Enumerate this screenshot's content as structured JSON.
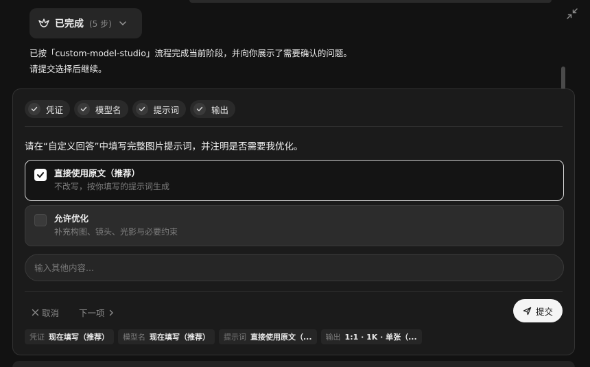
{
  "status": {
    "label": "已完成",
    "steps": "(5 步)"
  },
  "message": {
    "line1": "已按「custom-model-studio」流程完成当前阶段，并向你展示了需要确认的问题。",
    "line2": "请提交选择后继续。"
  },
  "chips": [
    "凭证",
    "模型名",
    "提示词",
    "输出"
  ],
  "question": "请在“自定义回答”中填写完整图片提示词，并注明是否需要我优化。",
  "options": [
    {
      "title": "直接使用原文（推荐）",
      "desc": "不改写，按你填写的提示词生成",
      "checked": true
    },
    {
      "title": "允许优化",
      "desc": "补充构图、镜头、光影与必要约束",
      "checked": false
    }
  ],
  "other_input": {
    "placeholder": "输入其他内容...",
    "value": ""
  },
  "actions": {
    "cancel": "取消",
    "next": "下一项",
    "submit": "提交"
  },
  "summary": [
    {
      "key": "凭证",
      "value": "现在填写（推荐）"
    },
    {
      "key": "模型名",
      "value": "现在填写（推荐）"
    },
    {
      "key": "提示词",
      "value": "直接使用原文（..."
    },
    {
      "key": "输出",
      "value": "1:1 · 1K · 单张（..."
    }
  ],
  "icons": {
    "status": "bird-icon",
    "collapse": "collapse-icon",
    "chip_check": "check-circle-icon",
    "option_check": "checkbox-icon",
    "cancel": "close-icon",
    "next": "chevron-right-icon",
    "submit": "send-icon"
  }
}
